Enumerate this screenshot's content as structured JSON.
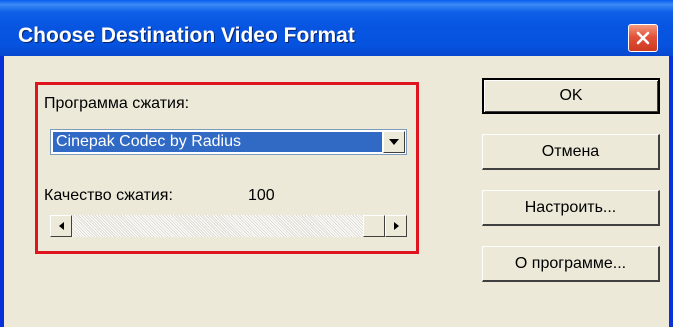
{
  "window": {
    "title": "Choose Destination Video Format",
    "close_icon": "close-icon"
  },
  "compression": {
    "program_label": "Программа сжатия:",
    "codec_selected": "Cinepak Codec by Radius",
    "quality_label": "Качество сжатия:",
    "quality_value": "100",
    "quality_level_percent": 100
  },
  "buttons": {
    "ok": "OK",
    "cancel": "Отмена",
    "configure": "Настроить...",
    "about": "О программе..."
  },
  "colors": {
    "titlebar": "#0654e0",
    "highlight_border": "#e0141e",
    "selection": "#316ac5",
    "face": "#ece9d8"
  }
}
